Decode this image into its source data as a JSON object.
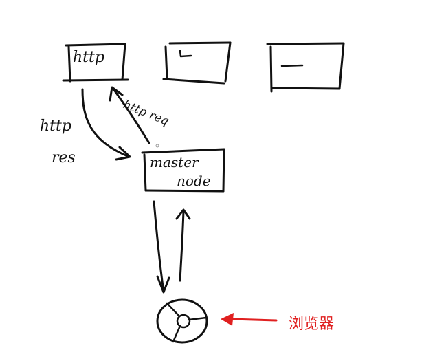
{
  "diagram": {
    "nodes": {
      "http_server": {
        "label": "http"
      },
      "master_node": {
        "line1": "master",
        "line2": "node"
      }
    },
    "edges": {
      "response": {
        "label_line1": "http",
        "label_line2": "res"
      },
      "request": {
        "label": "http req"
      }
    },
    "annotation": {
      "label": "浏览器",
      "color": "#e02020"
    },
    "icons": {
      "browser": "chrome-browser-icon"
    },
    "ink_color": "#111111"
  }
}
